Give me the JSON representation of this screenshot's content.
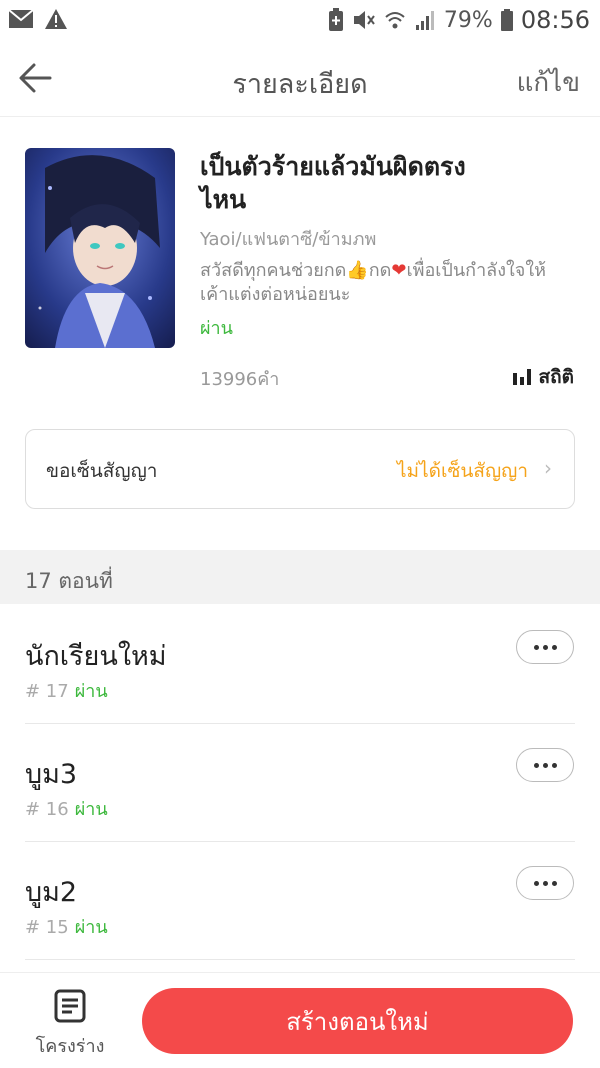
{
  "status_bar": {
    "battery": "79%",
    "time": "08:56"
  },
  "header": {
    "title": "รายละเอียด",
    "edit_label": "แก้ไข"
  },
  "book": {
    "title_line1": "เป็นตัวร้ายแล้วมันผิดตรง",
    "title_line2": "ไหน",
    "genre": "Yaoi/แฟนตาซี/ข้ามภพ",
    "desc_part1": "สวัสดีทุกคนช่วยกด",
    "desc_part2": "กด",
    "desc_part3": "เพื่อเป็นกำลังใจให้",
    "desc_line2": "เค้าแต่งต่อหน่อยนะ",
    "status": "ผ่าน",
    "word_count": "13996คำ",
    "stats_label": "สถิติ"
  },
  "contract": {
    "label": "ขอเซ็นสัญญา",
    "status": "ไม่ได้เซ็นสัญญา",
    "status_color": "#f5a31a"
  },
  "chapters_header": "17 ตอนที่",
  "chapters": [
    {
      "title": "นักเรียนใหม่",
      "number": "# 17",
      "status": "ผ่าน"
    },
    {
      "title": "บูม3",
      "number": "# 16",
      "status": "ผ่าน"
    },
    {
      "title": "บูม2",
      "number": "# 15",
      "status": "ผ่าน"
    }
  ],
  "bottom": {
    "outline_label": "โครงร่าง",
    "create_label": "สร้างตอนใหม่",
    "create_color": "#f44a4a"
  }
}
